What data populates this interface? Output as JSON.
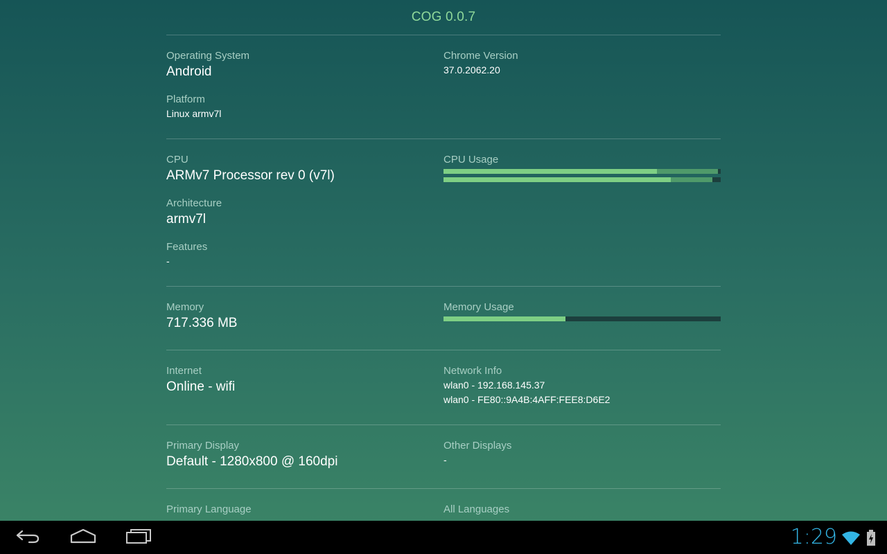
{
  "app": {
    "title": "COG 0.0.7",
    "colors": {
      "accent": "#8fd99a",
      "label": "#a8cfc4",
      "bar_fill": "#7ecf84",
      "bar_secondary": "#4f9a6a",
      "bar_track": "#1c3f3d",
      "clock": "#33b5e5"
    }
  },
  "system": {
    "os_label": "Operating System",
    "os_value": "Android",
    "platform_label": "Platform",
    "platform_value": "Linux armv7l",
    "chrome_label": "Chrome Version",
    "chrome_value": "37.0.2062.20"
  },
  "cpu": {
    "cpu_label": "CPU",
    "cpu_value": "ARMv7 Processor rev 0 (v7l)",
    "arch_label": "Architecture",
    "arch_value": "armv7l",
    "features_label": "Features",
    "features_value": "-",
    "usage_label": "CPU Usage",
    "usage": [
      {
        "primary": 0.77,
        "total": 0.99
      },
      {
        "primary": 0.82,
        "total": 0.97
      }
    ]
  },
  "memory": {
    "memory_label": "Memory",
    "memory_value": "717.336 MB",
    "usage_label": "Memory Usage",
    "usage": 0.44
  },
  "network": {
    "internet_label": "Internet",
    "internet_value": "Online - wifi",
    "info_label": "Network Info",
    "info_lines": [
      "wlan0 - 192.168.145.37",
      "wlan0 - FE80::9A4B:4AFF:FEE8:D6E2"
    ]
  },
  "display": {
    "primary_label": "Primary Display",
    "primary_value": "Default - 1280x800 @ 160dpi",
    "other_label": "Other Displays",
    "other_value": "-"
  },
  "language": {
    "primary_label": "Primary Language",
    "all_label": "All Languages"
  },
  "status_bar": {
    "time": "1:29",
    "icons": [
      "back-icon",
      "home-icon",
      "recent-apps-icon",
      "wifi-icon",
      "battery-charging-icon"
    ]
  }
}
